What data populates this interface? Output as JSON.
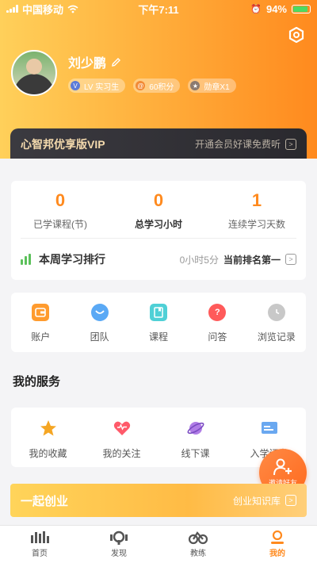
{
  "status_bar": {
    "carrier": "中国移动",
    "time": "下午7:11",
    "battery": "94%"
  },
  "profile": {
    "name": "刘少鹏",
    "badges": [
      {
        "icon": "V",
        "label": "LV  实习生"
      },
      {
        "icon": "@",
        "label": "60积分"
      },
      {
        "icon": "★",
        "label": "勋章X1"
      }
    ]
  },
  "vip": {
    "title": "心智邦优享版VIP",
    "link": "开通会员好课免费听",
    "arrow": ">"
  },
  "stats": {
    "items": [
      {
        "value": "0",
        "label": "已学课程(节)"
      },
      {
        "value": "0",
        "label": "总学习小时"
      },
      {
        "value": "1",
        "label": "连续学习天数"
      }
    ],
    "rank": {
      "title": "本周学习排行",
      "time": "0小时5分",
      "status": "当前排名第一",
      "arrow": ">"
    }
  },
  "quick": [
    {
      "icon": "wallet-icon",
      "label": "账户",
      "color": "#ff9b2e"
    },
    {
      "icon": "team-icon",
      "label": "团队",
      "color": "#5aa9f5"
    },
    {
      "icon": "course-icon",
      "label": "课程",
      "color": "#4fd0d6"
    },
    {
      "icon": "qa-icon",
      "label": "问答",
      "color": "#ff5a5a"
    },
    {
      "icon": "history-icon",
      "label": "浏览记录",
      "color": "#c8c8c8"
    }
  ],
  "services": {
    "title": "我的服务",
    "items": [
      {
        "icon": "star-icon",
        "label": "我的收藏"
      },
      {
        "icon": "heart-icon",
        "label": "我的关注"
      },
      {
        "icon": "planet-icon",
        "label": "线下课"
      },
      {
        "icon": "card-icon",
        "label": "入学证书"
      }
    ]
  },
  "invite": {
    "label": "邀请好友"
  },
  "venture": {
    "title": "一起创业",
    "link": "创业知识库",
    "arrow": ">"
  },
  "tabs": [
    {
      "label": "首页"
    },
    {
      "label": "发现"
    },
    {
      "label": "教练"
    },
    {
      "label": "我的"
    }
  ],
  "colors": {
    "accent": "#ff8a1e",
    "vip_text": "#f3d9ad",
    "rank_green": "#5bc05a"
  }
}
